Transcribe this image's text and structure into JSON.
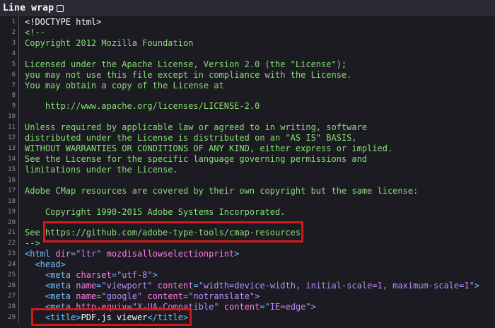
{
  "toolbar": {
    "line_wrap_label": "Line wrap"
  },
  "lines": [
    {
      "n": "1",
      "parts": [
        [
          "txt",
          "<!DOCTYPE html>"
        ]
      ]
    },
    {
      "n": "2",
      "parts": [
        [
          "comment",
          "<!--"
        ]
      ]
    },
    {
      "n": "3",
      "parts": [
        [
          "comment",
          "Copyright 2012 Mozilla Foundation"
        ]
      ]
    },
    {
      "n": "4",
      "parts": []
    },
    {
      "n": "5",
      "parts": [
        [
          "comment",
          "Licensed under the Apache License, Version 2.0 (the \"License\");"
        ]
      ]
    },
    {
      "n": "6",
      "parts": [
        [
          "comment",
          "you may not use this file except in compliance with the License."
        ]
      ]
    },
    {
      "n": "7",
      "parts": [
        [
          "comment",
          "You may obtain a copy of the License at"
        ]
      ]
    },
    {
      "n": "8",
      "parts": []
    },
    {
      "n": "9",
      "parts": [
        [
          "comment",
          "    http://www.apache.org/licenses/LICENSE-2.0"
        ]
      ]
    },
    {
      "n": "10",
      "parts": []
    },
    {
      "n": "11",
      "parts": [
        [
          "comment",
          "Unless required by applicable law or agreed to in writing, software"
        ]
      ]
    },
    {
      "n": "12",
      "parts": [
        [
          "comment",
          "distributed under the License is distributed on an \"AS IS\" BASIS,"
        ]
      ]
    },
    {
      "n": "13",
      "parts": [
        [
          "comment",
          "WITHOUT WARRANTIES OR CONDITIONS OF ANY KIND, either express or implied."
        ]
      ]
    },
    {
      "n": "14",
      "parts": [
        [
          "comment",
          "See the License for the specific language governing permissions and"
        ]
      ]
    },
    {
      "n": "15",
      "parts": [
        [
          "comment",
          "limitations under the License."
        ]
      ]
    },
    {
      "n": "16",
      "parts": []
    },
    {
      "n": "17",
      "parts": [
        [
          "comment",
          "Adobe CMap resources are covered by their own copyright but the same license:"
        ]
      ]
    },
    {
      "n": "18",
      "parts": []
    },
    {
      "n": "19",
      "parts": [
        [
          "comment",
          "    Copyright 1990-2015 Adobe Systems Incorporated."
        ]
      ]
    },
    {
      "n": "20",
      "parts": []
    },
    {
      "n": "21",
      "parts": [
        [
          "comment",
          "See https://github.com/adobe-type-tools/cmap-resources"
        ]
      ]
    },
    {
      "n": "22",
      "parts": [
        [
          "comment",
          "-->"
        ]
      ]
    },
    {
      "n": "23",
      "parts": [
        [
          "tag",
          "<html "
        ],
        [
          "attr",
          "dir"
        ],
        [
          "tag",
          "="
        ],
        [
          "val",
          "\"ltr\""
        ],
        [
          "tag",
          " "
        ],
        [
          "attr",
          "mozdisallowselectionprint"
        ],
        [
          "tag",
          ">"
        ]
      ]
    },
    {
      "n": "24",
      "parts": [
        [
          "tag",
          "  <head>"
        ]
      ]
    },
    {
      "n": "25",
      "parts": [
        [
          "tag",
          "    <meta "
        ],
        [
          "attr",
          "charset"
        ],
        [
          "tag",
          "="
        ],
        [
          "val",
          "\"utf-8\""
        ],
        [
          "tag",
          ">"
        ]
      ]
    },
    {
      "n": "26",
      "parts": [
        [
          "tag",
          "    <meta "
        ],
        [
          "attr",
          "name"
        ],
        [
          "tag",
          "="
        ],
        [
          "val",
          "\"viewport\""
        ],
        [
          "tag",
          " "
        ],
        [
          "attr",
          "content"
        ],
        [
          "tag",
          "="
        ],
        [
          "val",
          "\"width=device-width, initial-scale=1, maximum-scale=1\""
        ],
        [
          "tag",
          ">"
        ]
      ]
    },
    {
      "n": "27",
      "parts": [
        [
          "tag",
          "    <meta "
        ],
        [
          "attr",
          "name"
        ],
        [
          "tag",
          "="
        ],
        [
          "val",
          "\"google\""
        ],
        [
          "tag",
          " "
        ],
        [
          "attr",
          "content"
        ],
        [
          "tag",
          "="
        ],
        [
          "val",
          "\"notranslate\""
        ],
        [
          "tag",
          ">"
        ]
      ]
    },
    {
      "n": "28",
      "parts": [
        [
          "tag",
          "    <meta "
        ],
        [
          "attr",
          "http-equiv"
        ],
        [
          "tag",
          "="
        ],
        [
          "val",
          "\"X-UA-Compatible\""
        ],
        [
          "tag",
          " "
        ],
        [
          "attr",
          "content"
        ],
        [
          "tag",
          "="
        ],
        [
          "val",
          "\"IE=edge\""
        ],
        [
          "tag",
          ">"
        ]
      ]
    },
    {
      "n": "29",
      "parts": [
        [
          "tag",
          "    <title>"
        ],
        [
          "txt",
          "PDF.js viewer"
        ],
        [
          "tag",
          "</title>"
        ]
      ]
    }
  ],
  "colors": {
    "background": "#1c1b22",
    "comment": "#86de74",
    "tag": "#75bfff",
    "attribute": "#ff7de9",
    "value": "#b98eff",
    "highlight": "#d11a1a"
  }
}
